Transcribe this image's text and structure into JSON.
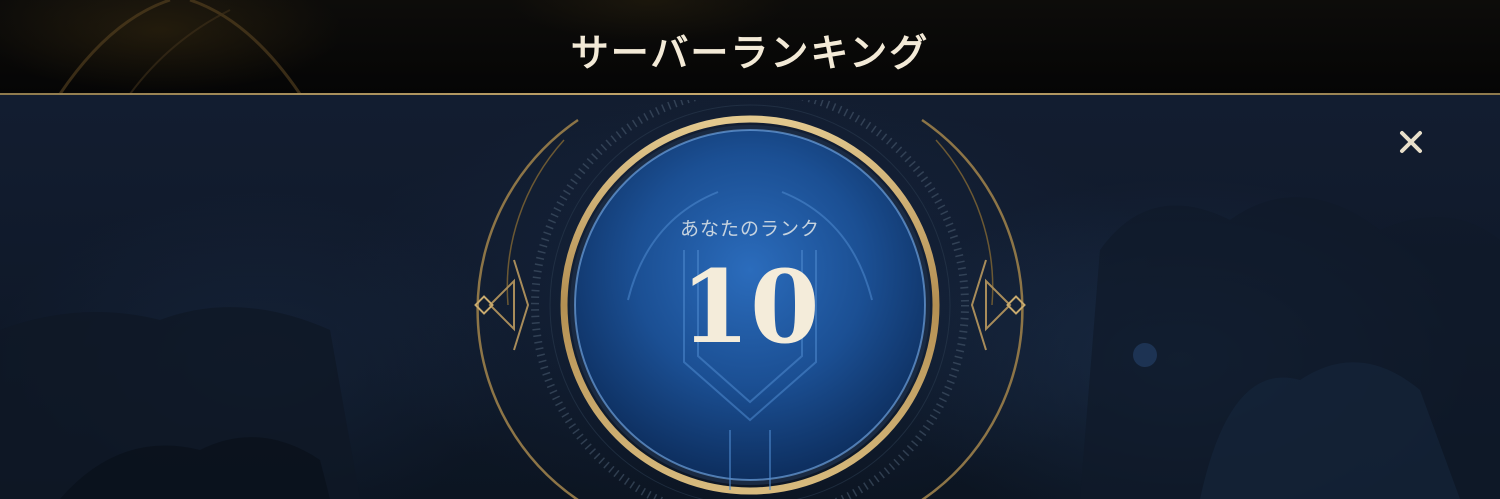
{
  "header": {
    "title": "サーバーランキング"
  },
  "rank": {
    "label": "あなたのランク",
    "value": "10"
  },
  "controls": {
    "close_icon": "close-icon"
  },
  "colors": {
    "gold": "#c8aa6e",
    "orb_blue": "#1f5ea8",
    "text_light": "#f4ecda",
    "background": "#111b2d"
  }
}
